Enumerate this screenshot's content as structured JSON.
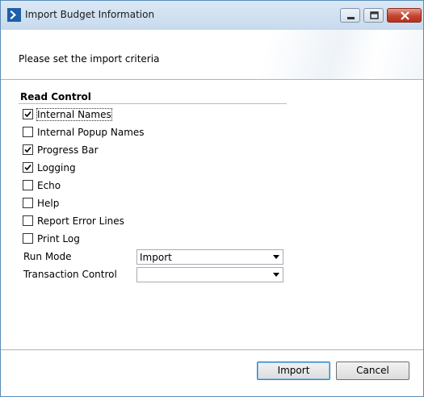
{
  "window": {
    "title": "Import Budget Information",
    "icon": "chevron-right-icon"
  },
  "title_controls": [
    "minimize-icon",
    "maximize-icon",
    "close-icon"
  ],
  "header": {
    "subtitle": "Please set the import criteria"
  },
  "read_control": {
    "title": "Read Control",
    "checkboxes": [
      {
        "label": "Internal Names",
        "checked": true
      },
      {
        "label": "Internal Popup Names",
        "checked": false
      },
      {
        "label": "Progress Bar",
        "checked": true
      },
      {
        "label": "Logging",
        "checked": true
      },
      {
        "label": "Echo",
        "checked": false
      },
      {
        "label": "Help",
        "checked": false
      },
      {
        "label": "Report Error Lines",
        "checked": false
      },
      {
        "label": "Print Log",
        "checked": false
      }
    ]
  },
  "fields": {
    "run_mode": {
      "label": "Run Mode",
      "value": "Import"
    },
    "transaction_control": {
      "label": "Transaction Control",
      "value": ""
    }
  },
  "buttons": {
    "import": "Import",
    "cancel": "Cancel"
  },
  "colors": {
    "accent": "#1f5fa8",
    "titlebar": "#c7daed",
    "close": "#c54431"
  }
}
